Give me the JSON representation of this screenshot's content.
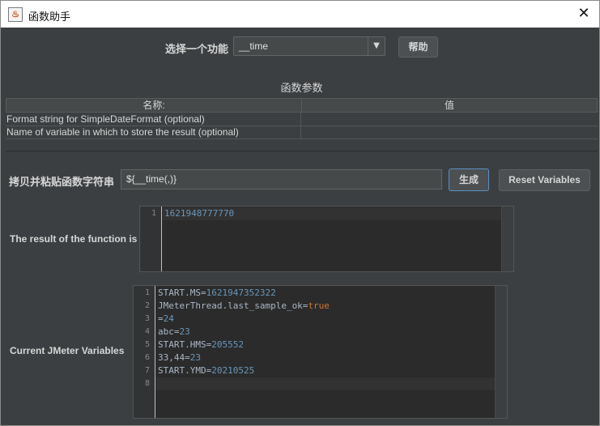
{
  "window": {
    "title": "函数助手",
    "close_glyph": "✕"
  },
  "function_picker": {
    "label": "选择一个功能",
    "selected": "__time",
    "help_label": "帮助"
  },
  "params": {
    "heading": "函数参数",
    "columns": [
      "名称:",
      "值"
    ],
    "rows": [
      {
        "name": "Format string for SimpleDateFormat (optional)",
        "value": ""
      },
      {
        "name": "Name of variable in which to store the result (optional)",
        "value": ""
      }
    ]
  },
  "copy": {
    "label": "拷贝并粘贴函数字符串",
    "value": "${__time(,)}",
    "generate_label": "生成",
    "reset_label": "Reset Variables"
  },
  "result": {
    "label": "The result of the function is",
    "lines": [
      {
        "n": "1",
        "text": "1621948777770"
      }
    ]
  },
  "variables": {
    "label": "Current JMeter Variables",
    "lines": [
      {
        "n": "1",
        "text": "START.MS=1621947352322"
      },
      {
        "n": "2",
        "text": "JMeterThread.last_sample_ok=true"
      },
      {
        "n": "3",
        "text": "=24"
      },
      {
        "n": "4",
        "text": "abc=23"
      },
      {
        "n": "5",
        "text": "START.HMS=205552"
      },
      {
        "n": "6",
        "text": "33,44=23"
      },
      {
        "n": "7",
        "text": "START.YMD=20210525"
      },
      {
        "n": "8",
        "text": ""
      }
    ]
  },
  "colors": {
    "background": "#3c3f41",
    "editor": "#2b2b2b",
    "number": "#6897bb",
    "keyword": "#cc7832",
    "accent": "#5b8fc7"
  }
}
